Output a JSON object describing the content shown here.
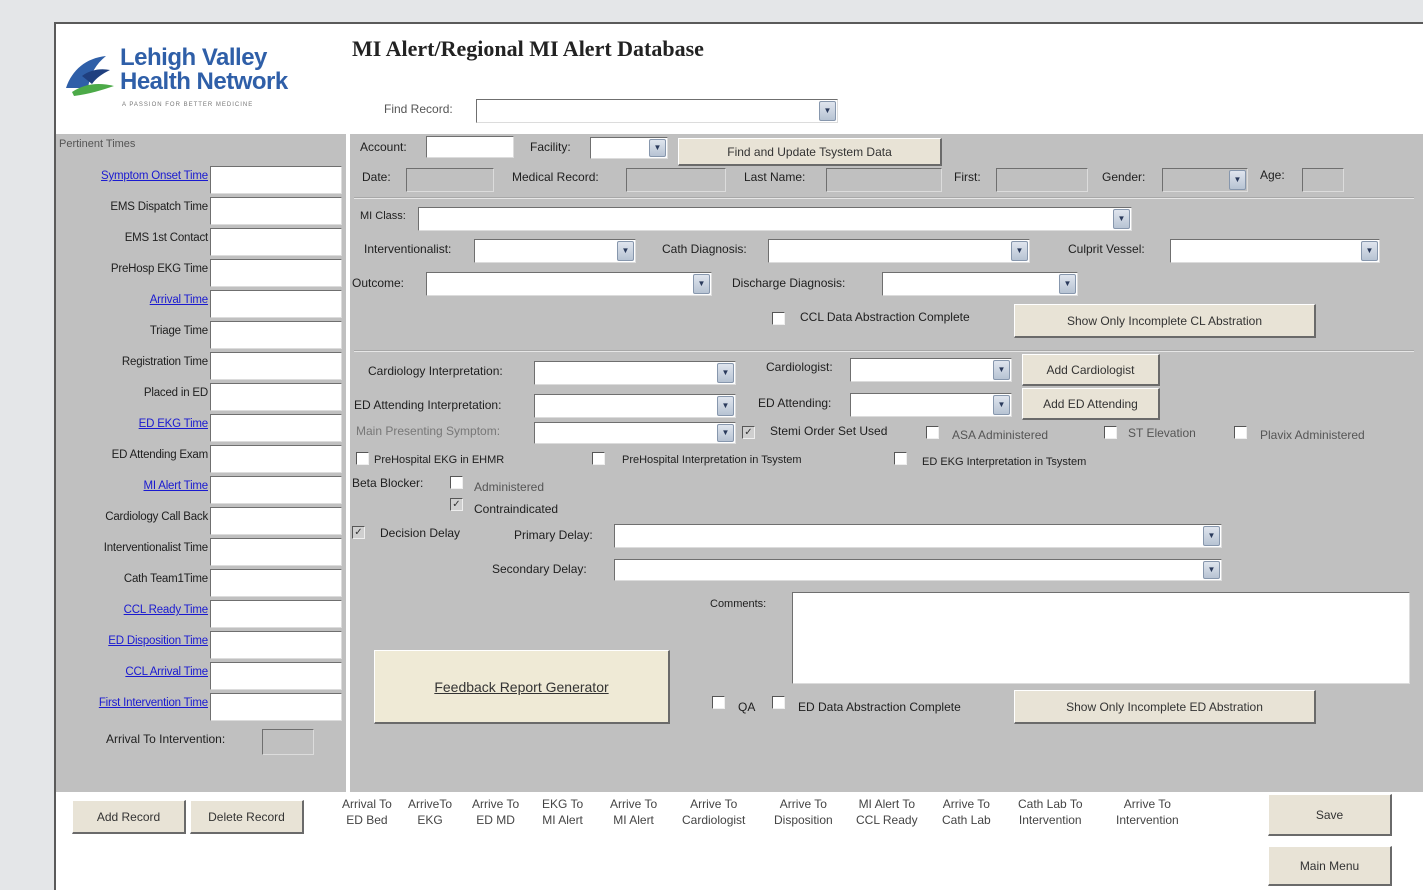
{
  "logo": {
    "line1": "Lehigh Valley",
    "line2": "Health Network",
    "tagline": "A PASSION FOR BETTER MEDICINE"
  },
  "title": "MI Alert/Regional MI Alert Database",
  "find_record_label": "Find Record:",
  "pertinent_times": {
    "heading": "Pertinent Times",
    "fields": [
      {
        "label": "Symptom Onset Time",
        "link": true
      },
      {
        "label": "EMS Dispatch Time",
        "link": false
      },
      {
        "label": "EMS 1st Contact",
        "link": false
      },
      {
        "label": "PreHosp EKG Time",
        "link": false
      },
      {
        "label": "Arrival Time",
        "link": true
      },
      {
        "label": "Triage Time",
        "link": false
      },
      {
        "label": "Registration Time",
        "link": false
      },
      {
        "label": "Placed in ED",
        "link": false
      },
      {
        "label": "ED EKG Time",
        "link": true
      },
      {
        "label": "ED Attending Exam",
        "link": false
      },
      {
        "label": "MI Alert Time",
        "link": true
      },
      {
        "label": "Cardiology Call Back",
        "link": false
      },
      {
        "label": "Interventionalist Time",
        "link": false
      },
      {
        "label": "Cath Team1Time",
        "link": false
      },
      {
        "label": "CCL Ready Time",
        "link": true
      },
      {
        "label": "ED Disposition Time",
        "link": true
      },
      {
        "label": "CCL Arrival Time",
        "link": true
      },
      {
        "label": "First Intervention Time",
        "link": true
      }
    ],
    "arrival_to_intervention_label": "Arrival To Intervention:"
  },
  "top_row": {
    "account": "Account:",
    "facility": "Facility:",
    "find_update_button": "Find and Update Tsystem Data",
    "date": "Date:",
    "medical_record": "Medical Record:",
    "last_name": "Last Name:",
    "first": "First:",
    "gender": "Gender:",
    "age": "Age:"
  },
  "cath": {
    "mi_class": "MI Class:",
    "interventionalist": "Interventionalist:",
    "cath_diagnosis": "Cath Diagnosis:",
    "culprit_vessel": "Culprit Vessel:",
    "outcome": "Outcome:",
    "discharge_diagnosis": "Discharge Diagnosis:",
    "ccl_complete": "CCL Data Abstraction Complete",
    "show_incomplete_cl": "Show Only Incomplete CL Abstration"
  },
  "ed": {
    "cardiology_interpretation": "Cardiology Interpretation:",
    "cardiologist": "Cardiologist:",
    "add_cardiologist": "Add Cardiologist",
    "ed_attending_interpretation": "ED Attending Interpretation:",
    "ed_attending": "ED Attending:",
    "add_ed_attending": "Add ED Attending",
    "main_presenting_symptom": "Main Presenting Symptom:",
    "stemi_order_set": "Stemi Order Set Used",
    "asa": "ASA Administered",
    "st_elevation": "ST Elevation",
    "plavix": "Plavix Administered",
    "prehospital_ekg_ehmr": "PreHospital EKG in EHMR",
    "prehospital_interp_tsystem": "PreHospital Interpretation in Tsystem",
    "ed_ekg_interp_tsystem": "ED EKG Interpretation in Tsystem",
    "beta_blocker": "Beta Blocker:",
    "administered": "Administered",
    "contraindicated": "Contraindicated",
    "decision_delay": "Decision Delay",
    "primary_delay": "Primary Delay:",
    "secondary_delay": "Secondary Delay:",
    "comments": "Comments:",
    "feedback_report": "Feedback Report Generator",
    "qa": "QA",
    "ed_complete": "ED Data Abstraction Complete",
    "show_incomplete_ed": "Show Only Incomplete ED Abstration"
  },
  "footer": {
    "add_record": "Add Record",
    "delete_record": "Delete Record",
    "save": "Save",
    "main_menu": "Main Menu",
    "metrics": [
      {
        "l1": "Arrival To",
        "l2": "ED Bed"
      },
      {
        "l1": "ArriveTo",
        "l2": "EKG"
      },
      {
        "l1": "Arrive To",
        "l2": "ED MD"
      },
      {
        "l1": "EKG To",
        "l2": "MI Alert"
      },
      {
        "l1": "Arrive To",
        "l2": "MI Alert"
      },
      {
        "l1": "Arrive To",
        "l2": "Cardiologist"
      },
      {
        "l1": "Arrive To",
        "l2": "Disposition"
      },
      {
        "l1": "MI Alert To",
        "l2": "CCL Ready"
      },
      {
        "l1": "Arrive To",
        "l2": "Cath Lab"
      },
      {
        "l1": "Cath Lab To",
        "l2": "Intervention"
      },
      {
        "l1": "Arrive To",
        "l2": "Intervention"
      }
    ]
  }
}
